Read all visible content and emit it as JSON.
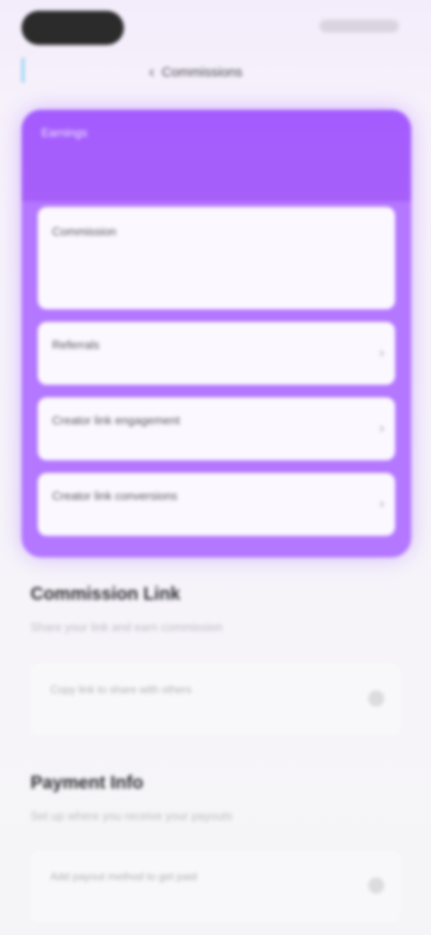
{
  "header": {
    "title": "Commissions"
  },
  "card": {
    "headline": "Earnings"
  },
  "panels": [
    {
      "label": "Commission",
      "sub": ""
    },
    {
      "label": "Referrals",
      "sub": ""
    },
    {
      "label": "Creator link engagement",
      "sub": ""
    },
    {
      "label": "Creator link conversions",
      "sub": ""
    }
  ],
  "sections": [
    {
      "title": "Commission Link",
      "desc": "Share your link and earn commission",
      "row_label": "Copy link to share with others"
    },
    {
      "title": "Payment Info",
      "desc": "Set up where you receive your payouts",
      "row_label": "Add payout method to get paid"
    }
  ]
}
